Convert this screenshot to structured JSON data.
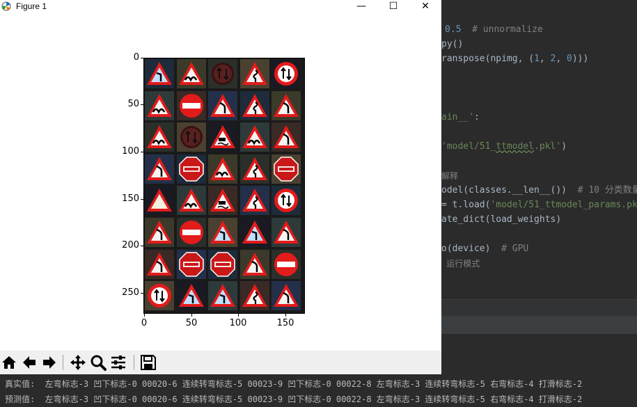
{
  "window": {
    "title": "Figure 1",
    "minimize_glyph": "—",
    "maximize_glyph": "☐",
    "close_glyph": "✕"
  },
  "plot": {
    "y_ticks": [
      "0",
      "50",
      "100",
      "150",
      "200",
      "250"
    ],
    "x_ticks": [
      "0",
      "50",
      "100",
      "150"
    ],
    "grid_rows": 8,
    "grid_cols": 5,
    "images": [
      [
        "sign-arrow-left",
        "sign-bump",
        "sign-no-entry-arrows",
        "sign-winding",
        "sign-no-overtake"
      ],
      [
        "sign-bump",
        "sign-no-entry",
        "sign-curve-left",
        "sign-winding",
        "sign-curve-left"
      ],
      [
        "sign-bump",
        "sign-no-entry-arrows",
        "sign-slippery",
        "sign-bump",
        "sign-curve-left"
      ],
      [
        "sign-curve-left",
        "sign-stop",
        "sign-bump",
        "sign-winding",
        "sign-stop"
      ],
      [
        "sign-blank",
        "sign-bump",
        "sign-slippery",
        "sign-winding",
        "sign-no-overtake"
      ],
      [
        "sign-curve-left",
        "sign-no-entry",
        "sign-arrow-left",
        "sign-arrow-left",
        "sign-curve-left"
      ],
      [
        "sign-curve-left",
        "sign-stop",
        "sign-stop",
        "sign-curve-left",
        "sign-no-entry"
      ],
      [
        "sign-no-overtake",
        "sign-arrow-left",
        "sign-arrow-left",
        "sign-winding",
        "sign-curve-left"
      ]
    ]
  },
  "toolbar": {
    "icons": [
      "home-icon",
      "back-icon",
      "forward-icon",
      "pan-icon",
      "zoom-icon",
      "configure-icon",
      "save-icon"
    ]
  },
  "ide": {
    "line1_num": "0.5",
    "line1_cmt": "# unnormalize",
    "line2": "py()",
    "line3_a": "ranspose(npimg, (",
    "line3_n1": "1",
    "line3_c": ", ",
    "line3_n2": "2",
    "line3_d": ", ",
    "line3_n3": "0",
    "line3_e": ")))",
    "line4_a": "ain__'",
    "line4_b": ":",
    "line5_a": "'model/51_",
    "line5_b": "ttmodel",
    "line5_c": ".pkl'",
    "line5_d": ")",
    "line6": "解释",
    "line7_a": "odel(classes.__len__())  ",
    "line7_b": "# 10 分类数量",
    "line8_a": "= t.load(",
    "line8_b": "'model/51_ttmodel_params.pk",
    "line9": "ate_dict(load_weights)",
    "line10_a": "o(device)  ",
    "line10_b": "# GPU",
    "line11": " 运行模式"
  },
  "console": {
    "line1": "真实值:  左弯标志-3 凹下标志-0 00020-6 连续转弯标志-5 00023-9 凹下标志-0 00022-8 左弯标志-3 连续转弯标志-5 右弯标志-4 打滑标志-2",
    "line2": "预测值:  左弯标志-3 凹下标志-0 00020-6 连续转弯标志-5 00023-9 凹下标志-0 00022-8 左弯标志-3 连续转弯标志-5 右弯标志-4 打滑标志-2"
  }
}
